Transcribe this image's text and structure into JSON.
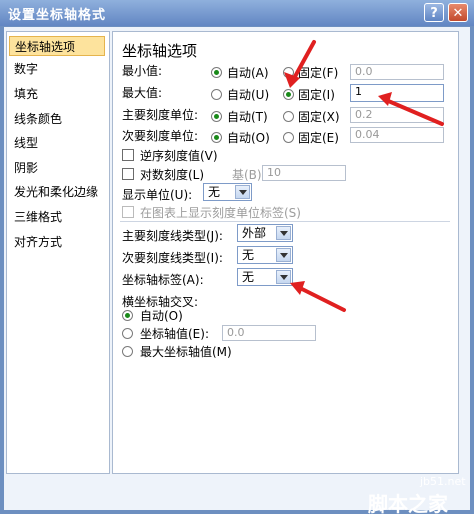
{
  "window": {
    "title": "设置坐标轴格式",
    "help": "?",
    "close": "✕"
  },
  "nav": {
    "items": [
      "坐标轴选项",
      "数字",
      "填充",
      "线条颜色",
      "线型",
      "阴影",
      "发光和柔化边缘",
      "三维格式",
      "对齐方式"
    ],
    "selected": 0
  },
  "panel": {
    "title": "坐标轴选项",
    "rows": [
      {
        "label": "最小值:",
        "auto": "自动(A)",
        "fixed": "固定(F)",
        "value": "0.0",
        "selected": "auto"
      },
      {
        "label": "最大值:",
        "auto": "自动(U)",
        "fixed": "固定(I)",
        "value": "1",
        "selected": "fixed"
      },
      {
        "label": "主要刻度单位:",
        "auto": "自动(T)",
        "fixed": "固定(X)",
        "value": "0.2",
        "selected": "auto"
      },
      {
        "label": "次要刻度单位:",
        "auto": "自动(O)",
        "fixed": "固定(E)",
        "value": "0.04",
        "selected": "auto"
      }
    ],
    "reverse": "逆序刻度值(V)",
    "log": "对数刻度(L)",
    "base_label": "基(B):",
    "base_value": "10",
    "display_unit_label": "显示单位(U):",
    "display_unit_value": "无",
    "show_unit_label": "在图表上显示刻度单位标签(S)",
    "major_tick_label": "主要刻度线类型(J):",
    "major_tick_value": "外部",
    "minor_tick_label": "次要刻度线类型(I):",
    "minor_tick_value": "无",
    "axis_labels_label": "坐标轴标签(A):",
    "axis_labels_value": "无",
    "cross_title": "横坐标轴交叉:",
    "cross_auto": "自动(O)",
    "cross_value_label": "坐标轴值(E):",
    "cross_value": "0.0",
    "cross_max": "最大坐标轴值(M)"
  },
  "watermark": {
    "site": "jb51.net",
    "name": "脚本之家"
  },
  "colors": {
    "title_bar": "#6286c3",
    "selected_nav": "#fde39d",
    "arrow": "#e02020"
  }
}
